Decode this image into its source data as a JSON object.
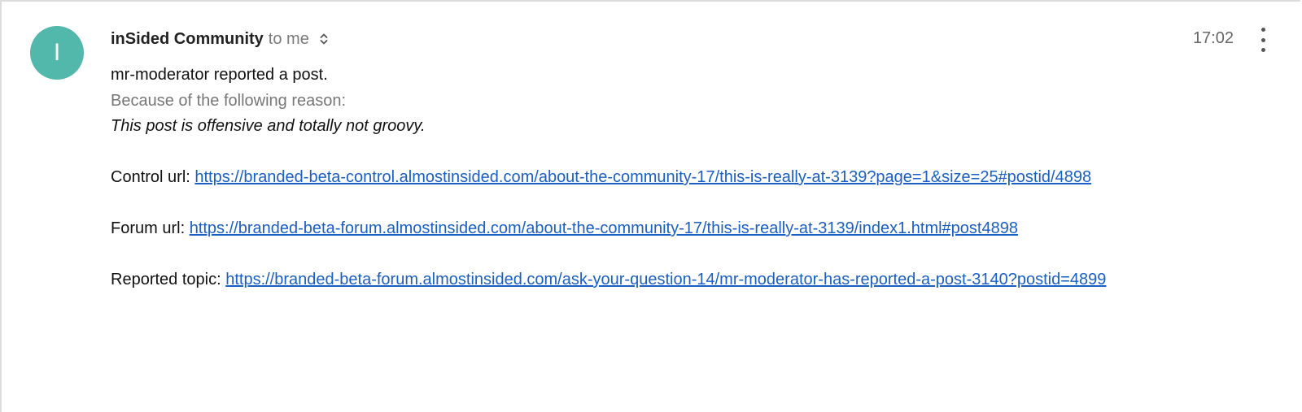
{
  "email": {
    "avatar_letter": "I",
    "avatar_color": "#53b8ac",
    "sender": "inSided Community",
    "recipient": "to me",
    "time": "17:02",
    "body": {
      "line1": "mr-moderator reported a post.",
      "line2": "Because of the following reason:",
      "line3": "This post is offensive and totally not groovy.",
      "control_label": "Control url:",
      "control_url": "https://branded-beta-control.almostinsided.com/about-the-community-17/this-is-really-at-3139?page=1&size=25#postid/4898",
      "forum_label": "Forum url:",
      "forum_url": "https://branded-beta-forum.almostinsided.com/about-the-community-17/this-is-really-at-3139/index1.html#post4898",
      "topic_label": "Reported topic:",
      "topic_url": "https://branded-beta-forum.almostinsided.com/ask-your-question-14/mr-moderator-has-reported-a-post-3140?postid=4899"
    }
  },
  "icons": {
    "expand": "chevron-up-down-icon",
    "menu": "more-vertical-icon"
  },
  "colors": {
    "link": "#1a5fc4",
    "muted_text": "#777777"
  }
}
